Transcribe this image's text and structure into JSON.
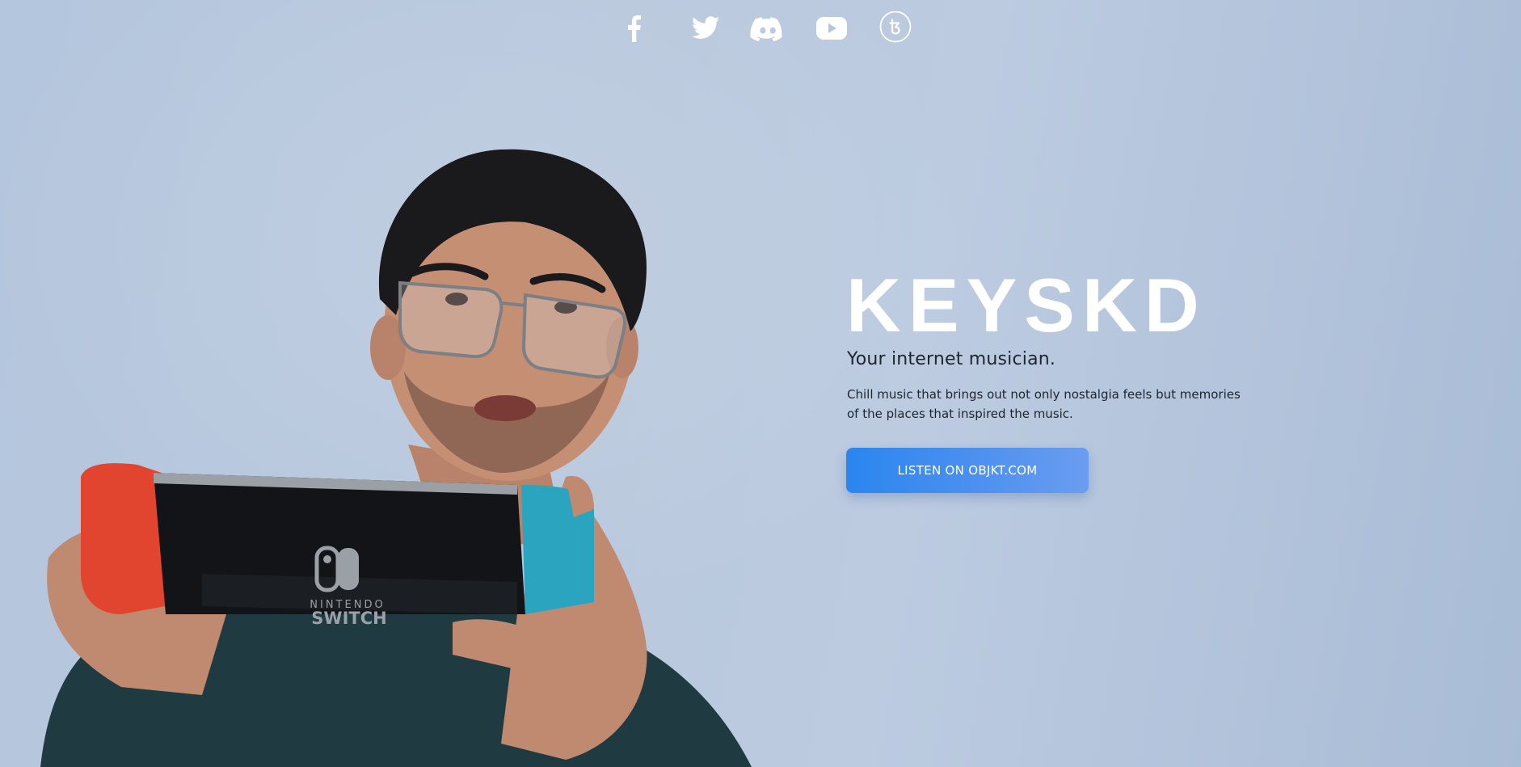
{
  "social": {
    "links": [
      {
        "icon": "facebook-icon"
      },
      {
        "icon": "twitter-icon"
      },
      {
        "icon": "discord-icon"
      },
      {
        "icon": "youtube-icon"
      },
      {
        "icon": "tezos-icon"
      }
    ]
  },
  "hero": {
    "title": "KEYSKD",
    "tagline": "Your internet musician.",
    "description": "Chill music that brings out not only nostalgia feels but memories of the places that inspired the music.",
    "cta_label": "LISTEN ON OBJKT.COM",
    "photo": {
      "console_brand_top": "NINTENDO",
      "console_brand_bottom": "SWITCH"
    }
  },
  "colors": {
    "background": "#b7c8de",
    "title": "#ffffff",
    "text": "#1e2530",
    "button_start": "#2a86ef",
    "button_end": "#6b9df0"
  }
}
